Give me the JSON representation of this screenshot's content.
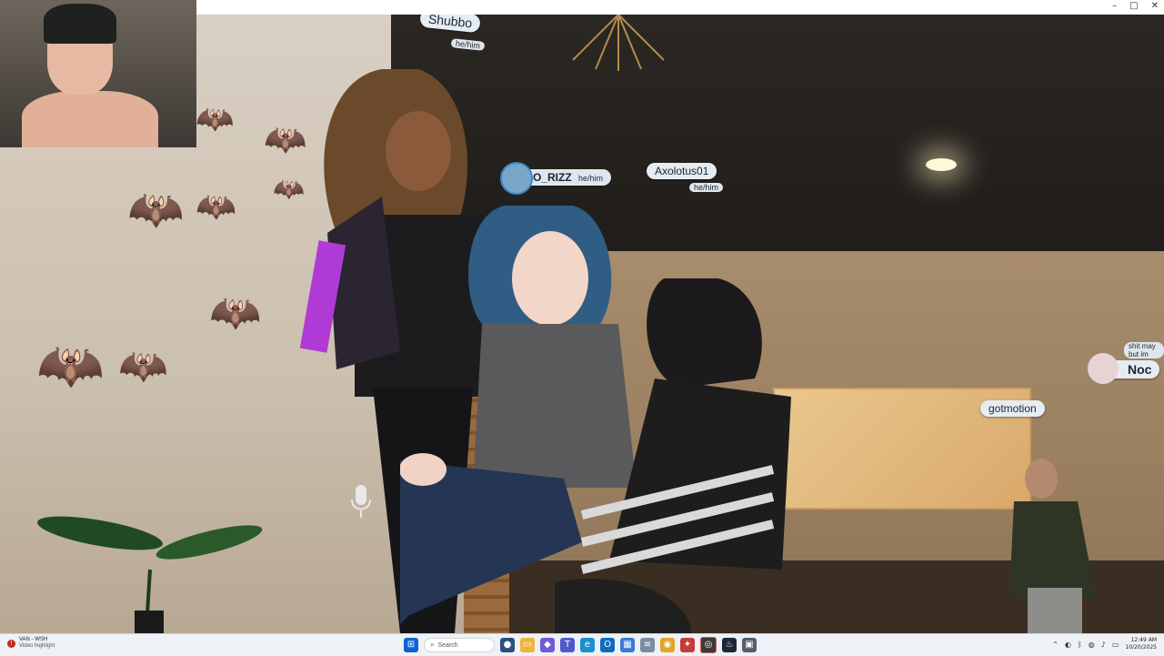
{
  "window": {
    "controls": {
      "minimize": "–",
      "maximize": "□",
      "close": "✕"
    }
  },
  "scene": {
    "nametags": [
      {
        "name": "Shubbo",
        "pronoun": "he/him"
      },
      {
        "name": "O_RIZZ",
        "pronoun": "he/him"
      },
      {
        "name": "Axolotus01",
        "pronoun": "he/him"
      },
      {
        "name": "Noc",
        "pronoun": "shit may but im"
      },
      {
        "name": "gotmotion",
        "pronoun": ""
      }
    ]
  },
  "taskbar": {
    "notification": {
      "title": "VAN - WSH",
      "subtitle": "Video highlight"
    },
    "search_placeholder": "Search",
    "pinned_icons": [
      "avatars-icon",
      "file-explorer-icon",
      "copilot-icon",
      "teams-icon",
      "edge-icon",
      "outlook-icon",
      "store-icon",
      "notepad-icon",
      "chrome-icon",
      "game-icon",
      "obs-icon",
      "steam-icon",
      "vr-icon"
    ],
    "clock": {
      "time": "12:49 AM",
      "date": "10/20/2025"
    }
  },
  "colors": {
    "taskbar_bg": "#eef1f6",
    "nametag_bg": "#e6ecf3",
    "windows_blue": "#0a63d6"
  }
}
